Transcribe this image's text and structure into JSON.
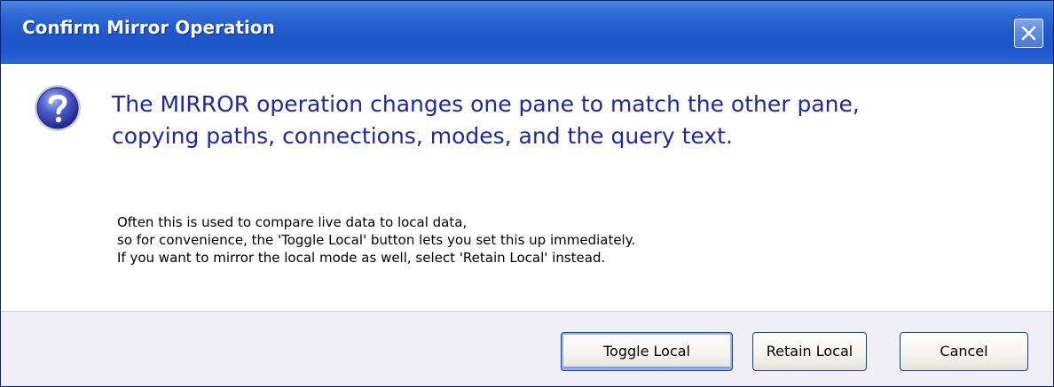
{
  "window": {
    "title": "Confirm Mirror Operation"
  },
  "icons": {
    "close": "close-icon",
    "question": "question-icon"
  },
  "message": {
    "main_lines": [
      "The MIRROR operation changes one pane to match the other pane,",
      "copying paths, connections, modes, and the query text."
    ],
    "detail_lines": [
      "Often this is used to compare live data to local data,",
      "so for convenience, the 'Toggle Local' button lets you set this up immediately.",
      "If you want to mirror the local mode as well, select 'Retain Local' instead."
    ]
  },
  "buttons": {
    "toggle_local": "Toggle Local",
    "retain_local": "Retain Local",
    "cancel": "Cancel"
  },
  "colors": {
    "title_bar": "#1e56c8",
    "main_instruction": "#1e2a9c",
    "footer": "#f0eef6"
  }
}
